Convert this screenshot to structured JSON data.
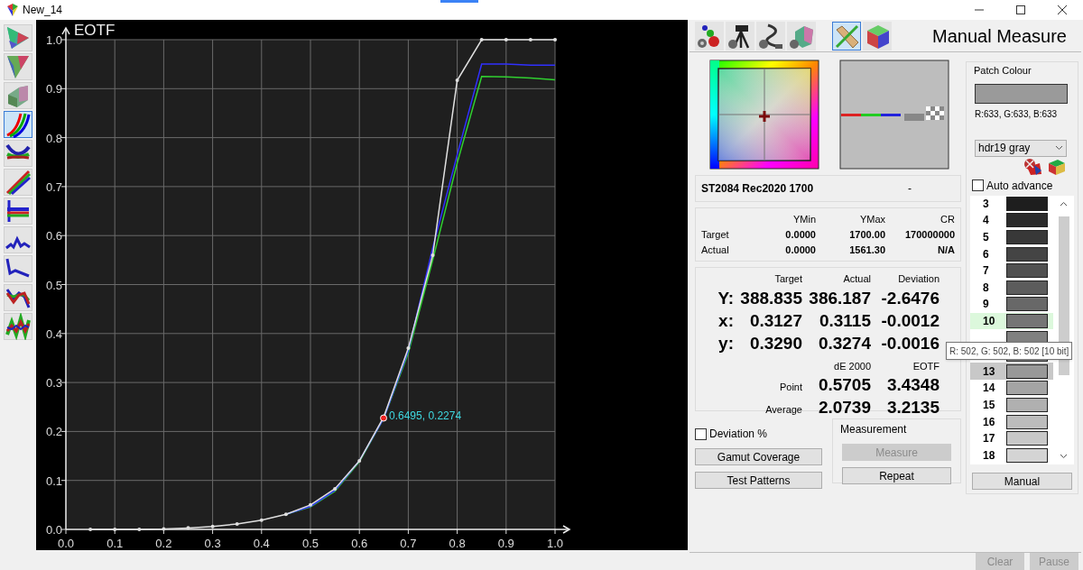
{
  "window": {
    "title": "New_14"
  },
  "left_toolbar": [
    {
      "kind": "triangle",
      "selected": false
    },
    {
      "kind": "triangle2",
      "selected": false
    },
    {
      "kind": "surface",
      "selected": false
    },
    {
      "kind": "curves",
      "selected": true
    },
    {
      "kind": "bands",
      "selected": false
    },
    {
      "kind": "ramps",
      "selected": false
    },
    {
      "kind": "balance",
      "selected": false
    },
    {
      "kind": "wave",
      "selected": false
    },
    {
      "kind": "drop",
      "selected": false
    },
    {
      "kind": "zigzag",
      "selected": false
    },
    {
      "kind": "noise",
      "selected": false
    }
  ],
  "chart_panel": {
    "chart_data": {
      "type": "line",
      "title": "EOTF",
      "grid": true,
      "xlim": [
        0,
        1
      ],
      "ylim": [
        0,
        1
      ],
      "xticks": [
        {
          "value": 0,
          "label": "0.0"
        },
        {
          "value": 0.1,
          "label": "0.1"
        },
        {
          "value": 0.2,
          "label": "0.2"
        },
        {
          "value": 0.3,
          "label": "0.3"
        },
        {
          "value": 0.4,
          "label": "0.4"
        },
        {
          "value": 0.5,
          "label": "0.5"
        },
        {
          "value": 0.6,
          "label": "0.6"
        },
        {
          "value": 0.7,
          "label": "0.7"
        },
        {
          "value": 0.8,
          "label": "0.8"
        },
        {
          "value": 0.9,
          "label": "0.9"
        },
        {
          "value": 1,
          "label": "1.0"
        }
      ],
      "yticks": [
        {
          "value": 0,
          "label": "0.0"
        },
        {
          "value": 0.1,
          "label": "0.1"
        },
        {
          "value": 0.2,
          "label": "0.2"
        },
        {
          "value": 0.3,
          "label": "0.3"
        },
        {
          "value": 0.4,
          "label": "0.4"
        },
        {
          "value": 0.5,
          "label": "0.5"
        },
        {
          "value": 0.6,
          "label": "0.6"
        },
        {
          "value": 0.7,
          "label": "0.7"
        },
        {
          "value": 0.8,
          "label": "0.8"
        },
        {
          "value": 0.9,
          "label": "0.9"
        },
        {
          "value": 1,
          "label": "1.0"
        }
      ],
      "x": [
        0.05,
        0.1,
        0.15,
        0.2,
        0.25,
        0.3,
        0.35,
        0.4,
        0.45,
        0.5,
        0.55,
        0.6,
        0.65,
        0.7,
        0.75,
        0.8,
        0.85,
        0.9,
        0.95,
        1.0
      ],
      "series": [
        {
          "color": "#e0e0e0",
          "values": [
            0,
            0,
            0,
            0.001,
            0.003,
            0.006,
            0.011,
            0.019,
            0.031,
            0.05,
            0.083,
            0.14,
            0.23,
            0.37,
            0.56,
            0.917,
            1.0,
            1.0,
            1.0,
            1.0
          ]
        },
        {
          "color": "#3030ff",
          "values": [
            null,
            null,
            null,
            null,
            null,
            null,
            null,
            null,
            0.031,
            0.047,
            0.08,
            0.14,
            0.227,
            0.365,
            0.575,
            0.765,
            0.95,
            0.95,
            0.948,
            0.948
          ]
        },
        {
          "color": "#30d030",
          "values": [
            null,
            null,
            null,
            null,
            null,
            null,
            null,
            null,
            0.031,
            0.046,
            0.078,
            0.138,
            0.227,
            0.36,
            0.55,
            0.748,
            0.925,
            0.924,
            0.922,
            0.918
          ]
        }
      ],
      "annotations": [
        {
          "x": 0.6495,
          "y": 0.2274,
          "text": "0.6495, 0.2274"
        }
      ]
    }
  },
  "right_toolbar": [
    {
      "kind": "dots",
      "selected": false
    },
    {
      "kind": "tripod",
      "selected": false
    },
    {
      "kind": "cable",
      "selected": false
    },
    {
      "kind": "gamut",
      "selected": false
    },
    {
      "kind": "ruler",
      "selected": true
    },
    {
      "kind": "cube",
      "selected": false
    }
  ],
  "panel_title": "Manual Measure",
  "info": {
    "preset": "ST2084 Rec2020 1700",
    "status": "-"
  },
  "range_table": {
    "columns": [
      "YMin",
      "YMax",
      "CR"
    ],
    "rows": [
      {
        "label": "Target",
        "values": [
          "0.0000",
          "1700.00",
          "170000000"
        ]
      },
      {
        "label": "Actual",
        "values": [
          "0.0000",
          "1561.30",
          "N/A"
        ]
      }
    ]
  },
  "readings": {
    "columns": [
      "Target",
      "Actual",
      "Deviation"
    ],
    "rows": [
      {
        "label": "Y:",
        "values": [
          "388.835",
          "386.187",
          "-2.6476"
        ]
      },
      {
        "label": "x:",
        "values": [
          "0.3127",
          "0.3115",
          "-0.0012"
        ]
      },
      {
        "label": "y:",
        "values": [
          "0.3290",
          "0.3274",
          "-0.0016"
        ]
      }
    ]
  },
  "delta": {
    "columns": [
      "dE 2000",
      "EOTF"
    ],
    "rows": [
      {
        "label": "Point",
        "values": [
          "0.5705",
          "3.4348"
        ]
      },
      {
        "label": "Average",
        "values": [
          "2.0739",
          "3.2135"
        ]
      }
    ]
  },
  "deviation_percent": {
    "label": "Deviation %",
    "checked": false
  },
  "buttons": [
    {
      "label": "Gamut Coverage",
      "disabled": false
    },
    {
      "label": "Test Patterns",
      "disabled": false
    }
  ],
  "measurement": {
    "title": "Measurement",
    "buttons": [
      {
        "label": "Measure",
        "disabled": true
      },
      {
        "label": "Repeat",
        "disabled": false
      }
    ]
  },
  "patch_colour": {
    "title": "Patch Colour",
    "color": "#9a9a9a",
    "values": "R:633, G:633, B:633",
    "dropdown": "hdr19 gray",
    "auto_advance": {
      "label": "Auto advance",
      "checked": false
    },
    "patches": [
      {
        "label": "3",
        "color": "#1e1e1e",
        "selected": false,
        "measured": false
      },
      {
        "label": "4",
        "color": "#2b2b2b",
        "selected": false,
        "measured": false
      },
      {
        "label": "5",
        "color": "#383838",
        "selected": false,
        "measured": false
      },
      {
        "label": "6",
        "color": "#444444",
        "selected": false,
        "measured": false
      },
      {
        "label": "7",
        "color": "#505050",
        "selected": false,
        "measured": false
      },
      {
        "label": "8",
        "color": "#5c5c5c",
        "selected": false,
        "measured": false
      },
      {
        "label": "9",
        "color": "#686868",
        "selected": false,
        "measured": false
      },
      {
        "label": "10",
        "color": "#757575",
        "selected": false,
        "measured": true
      },
      {
        "color": "#808080",
        "selected": false,
        "measured": false
      },
      {
        "color": "#8c8c8c",
        "selected": false,
        "measured": false
      },
      {
        "label": "13",
        "color": "#989898",
        "selected": true,
        "measured": false
      },
      {
        "label": "14",
        "color": "#a4a4a4",
        "selected": false,
        "measured": false
      },
      {
        "label": "15",
        "color": "#b0b0b0",
        "selected": false,
        "measured": false
      },
      {
        "label": "16",
        "color": "#bcbcbc",
        "selected": false,
        "measured": false
      },
      {
        "label": "17",
        "color": "#c8c8c8",
        "selected": false,
        "measured": false
      },
      {
        "label": "18",
        "color": "#d4d4d4",
        "selected": false,
        "measured": false
      }
    ],
    "button": "Manual"
  },
  "tooltip": "R: 502, G: 502, B: 502 [10 bit]",
  "footer_buttons": [
    {
      "label": "Clear",
      "disabled": true
    },
    {
      "label": "Pause",
      "disabled": true
    }
  ]
}
